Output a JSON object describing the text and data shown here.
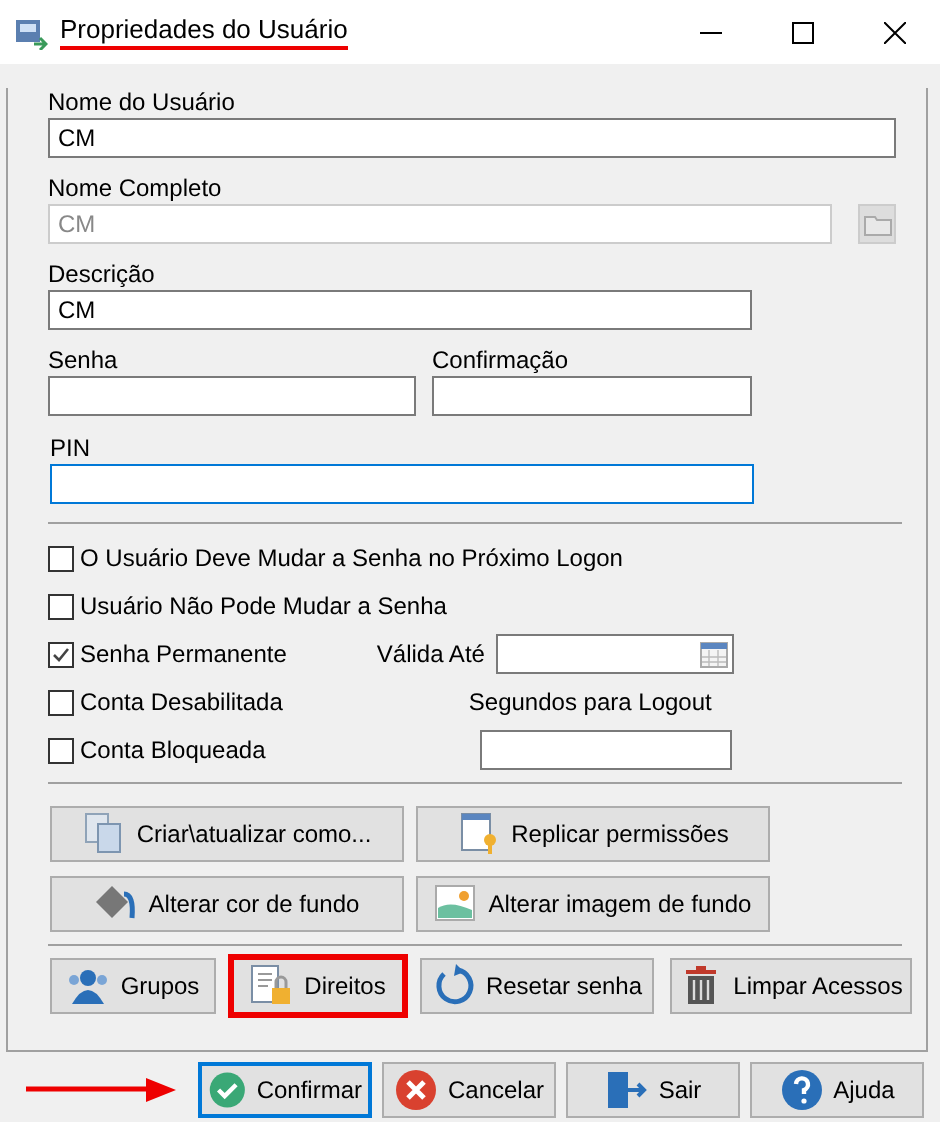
{
  "window": {
    "title": "Propriedades do Usuário",
    "title_underlined": true
  },
  "user_name": {
    "label": "Nome do Usuário",
    "value": "CM"
  },
  "full_name": {
    "label": "Nome Completo",
    "value": "CM",
    "disabled": true
  },
  "description": {
    "label": "Descrição",
    "value": "CM"
  },
  "password": {
    "label": "Senha"
  },
  "confirmation": {
    "label": "Confirmação"
  },
  "pin": {
    "label": "PIN",
    "focused": true
  },
  "options": [
    {
      "label": "O Usuário Deve Mudar a Senha no Próximo Logon",
      "checked": false
    },
    {
      "label": "Usuário Não Pode Mudar a Senha",
      "checked": false
    },
    {
      "label": "Senha Permanente",
      "checked": true
    },
    {
      "label": "Conta Desabilitada",
      "checked": false
    },
    {
      "label": "Conta Bloqueada",
      "checked": false
    }
  ],
  "valid_until": {
    "label": "Válida Até"
  },
  "logout_seconds": {
    "label": "Segundos para Logout"
  },
  "action_buttons": [
    {
      "label": "Criar\\atualizar como..."
    },
    {
      "label": "Replicar permissões"
    },
    {
      "label": "Alterar cor de fundo"
    },
    {
      "label": "Alterar imagem de fundo"
    }
  ],
  "account_buttons": [
    {
      "label": "Grupos",
      "highlighted": false
    },
    {
      "label": "Direitos",
      "highlighted": true
    },
    {
      "label": "Resetar senha",
      "highlighted": false
    },
    {
      "label": "Limpar Acessos",
      "highlighted": false
    }
  ],
  "footer_buttons": [
    {
      "label": "Confirmar",
      "focused": true
    },
    {
      "label": "Cancelar",
      "focused": false
    },
    {
      "label": "Sair",
      "focused": false
    },
    {
      "label": "Ajuda",
      "focused": false
    }
  ],
  "pointer_arrow": true
}
